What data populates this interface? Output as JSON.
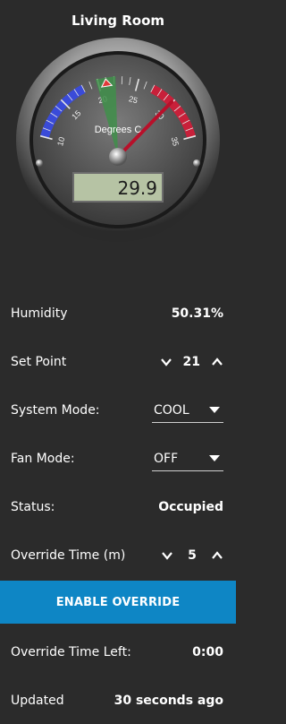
{
  "header": {
    "title": "Living Room"
  },
  "gauge": {
    "unit_label": "Degrees C",
    "ticks": [
      "10",
      "15",
      "20",
      "25",
      "30",
      "35"
    ],
    "reading": "29.9",
    "set_point_marker": 21,
    "needle_value": 29.9,
    "range": [
      10,
      35
    ],
    "colors": {
      "cold": "#3a4bd8",
      "hot": "#c8203a",
      "setpoint_zone": "#3f8f4a"
    }
  },
  "humidity": {
    "label": "Humidity",
    "value": "50.31%"
  },
  "set_point": {
    "label": "Set Point",
    "value": "21"
  },
  "system_mode": {
    "label": "System Mode:",
    "value": "COOL"
  },
  "fan_mode": {
    "label": "Fan Mode:",
    "value": "OFF"
  },
  "status": {
    "label": "Status:",
    "value": "Occupied"
  },
  "override_time": {
    "label": "Override Time (m)",
    "value": "5"
  },
  "override_button": {
    "label": "ENABLE OVERRIDE"
  },
  "override_left": {
    "label": "Override Time Left:",
    "value": "0:00"
  },
  "updated": {
    "label": "Updated",
    "value": "30 seconds ago"
  },
  "colors": {
    "accent": "#0e86c5",
    "background": "#2b2b2b"
  }
}
